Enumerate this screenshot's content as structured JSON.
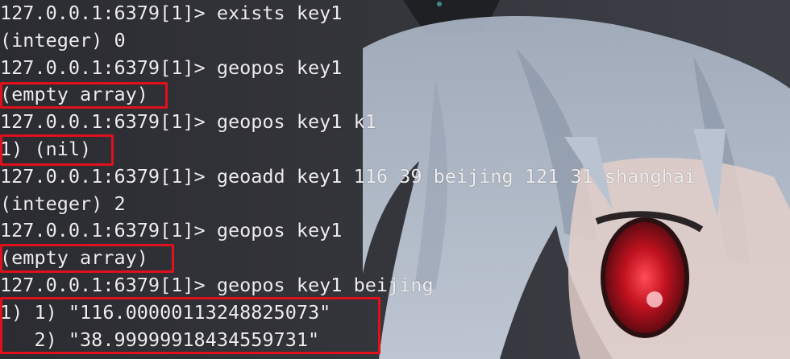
{
  "terminal": {
    "lines": [
      {
        "text": "127.0.0.1:6379[1]> exists key1",
        "kind": "command"
      },
      {
        "text": "(integer) 0",
        "kind": "output"
      },
      {
        "text": "127.0.0.1:6379[1]> geopos key1",
        "kind": "command"
      },
      {
        "text": "(empty array)",
        "kind": "output"
      },
      {
        "text": "127.0.0.1:6379[1]> geopos key1 k1",
        "kind": "command"
      },
      {
        "text": "1) (nil)",
        "kind": "output"
      },
      {
        "text": "127.0.0.1:6379[1]> geoadd key1 116 39 beijing 121 31 shanghai",
        "kind": "command"
      },
      {
        "text": "(integer) 2",
        "kind": "output"
      },
      {
        "text": "127.0.0.1:6379[1]> geopos key1",
        "kind": "command"
      },
      {
        "text": "(empty array)",
        "kind": "output"
      },
      {
        "text": "127.0.0.1:6379[1]> geopos key1 beijing",
        "kind": "command"
      },
      {
        "text": "1) 1) \"116.00000113248825073\"",
        "kind": "output"
      },
      {
        "text": "   2) \"38.99999918434559731\"",
        "kind": "output"
      }
    ]
  },
  "colors": {
    "text": "#eeeeee",
    "background": "#2f3036",
    "highlight": "#e0101c"
  }
}
